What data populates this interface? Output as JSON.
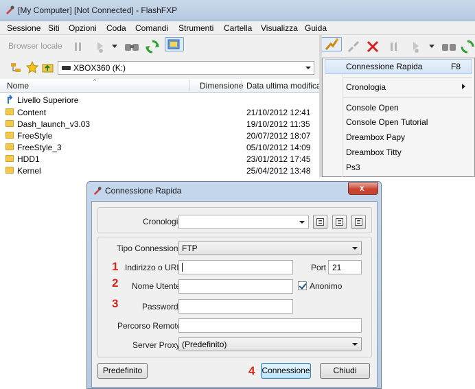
{
  "app": {
    "title": "[My Computer]   [Not Connected] - FlashFXP",
    "menu": [
      "Sessione",
      "Siti",
      "Opzioni",
      "Coda",
      "Comandi",
      "Strumenti",
      "Cartella",
      "Visualizza",
      "Guida"
    ],
    "toolbar": {
      "local_browser_label": "Browser locale"
    },
    "drive": "XBOX360 (K:)",
    "columns": {
      "name": "Nome",
      "size": "Dimensione",
      "modified": "Data ultima modifica"
    },
    "up_level": "Livello Superiore",
    "files": [
      {
        "name": "Content",
        "date": "21/10/2012 12:41"
      },
      {
        "name": "Dash_launch_v3.03",
        "date": "19/10/2012 11:35"
      },
      {
        "name": "FreeStyle",
        "date": "20/07/2012 18:07"
      },
      {
        "name": "FreeStyle_3",
        "date": "05/10/2012 14:09"
      },
      {
        "name": "HDD1",
        "date": "23/01/2012 17:45"
      },
      {
        "name": "Kernel",
        "date": "25/04/2012 13:48"
      }
    ]
  },
  "connect_menu": {
    "items": [
      {
        "label": "Connessione Rapida",
        "shortcut": "F8"
      },
      {
        "label": "Cronologia"
      },
      {
        "label": "Console Open"
      },
      {
        "label": "Console Open Tutorial"
      },
      {
        "label": "Dreambox Papy"
      },
      {
        "label": "Dreambox Titty"
      },
      {
        "label": "Ps3"
      }
    ]
  },
  "dialog": {
    "title": "Connessione Rapida",
    "close_glyph": "x",
    "history_label": "Cronologia",
    "history_value": "",
    "type_label": "Tipo Connessione",
    "type_value": "FTP",
    "url_label": "Indirizzo o URL",
    "url_value": "",
    "port_label": "Port",
    "port_value": "21",
    "user_label": "Nome Utente",
    "user_value": "",
    "anonymous_label": "Anonimo",
    "anonymous_checked": true,
    "password_label": "Password",
    "password_value": "",
    "remote_path_label": "Percorso Remoto",
    "remote_path_value": "",
    "proxy_label": "Server Proxy",
    "proxy_value": "(Predefinito)",
    "btn_default": "Predefinito",
    "btn_connect": "Connessione",
    "btn_close": "Chiudi",
    "step_numbers": [
      "1",
      "2",
      "3",
      "4"
    ]
  },
  "colors": {
    "step_number": "#d9261c",
    "title_bar": "#c9d9ea",
    "folder": "#f2c94c"
  }
}
